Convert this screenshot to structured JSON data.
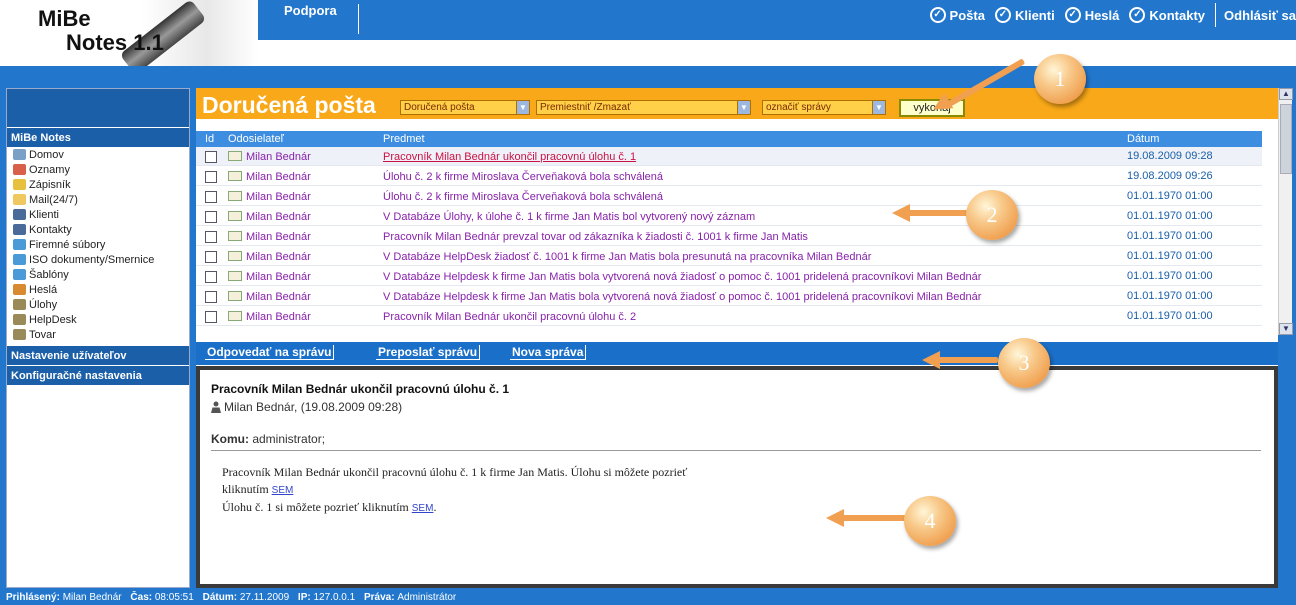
{
  "app": {
    "logo_line1": "MiBe",
    "logo_line2": "Notes 1.1"
  },
  "topnav": {
    "support": "Podpora",
    "links": [
      "Pošta",
      "Klienti",
      "Heslá",
      "Kontakty"
    ],
    "logout": "Odhlásiť sa"
  },
  "sidebar": {
    "section_title": "MiBe Notes",
    "items": [
      {
        "label": "Domov",
        "icon": "home-icon"
      },
      {
        "label": "Oznamy",
        "icon": "announcement-icon"
      },
      {
        "label": "Zápisník",
        "icon": "notepad-icon"
      },
      {
        "label": "Mail(24/7)",
        "icon": "mail-icon"
      },
      {
        "label": "Klienti",
        "icon": "contact-card-icon"
      },
      {
        "label": "Kontakty",
        "icon": "contact-card-icon"
      },
      {
        "label": "Firemné súbory",
        "icon": "folder-icon"
      },
      {
        "label": "ISO dokumenty/Smernice",
        "icon": "folder-icon"
      },
      {
        "label": "Šablóny",
        "icon": "folder-icon"
      },
      {
        "label": "Heslá",
        "icon": "key-icon"
      },
      {
        "label": "Úlohy",
        "icon": "task-icon"
      },
      {
        "label": "HelpDesk",
        "icon": "task-icon"
      },
      {
        "label": "Tovar",
        "icon": "task-icon"
      }
    ],
    "user_settings": "Nastavenie užívateľov",
    "config_settings": "Konfiguračné nastavenia"
  },
  "inbox": {
    "title": "Doručená pošta",
    "folder_select": "Doručená pošta",
    "action_select": "Premiestniť /Zmazať",
    "mark_select": "označiť správy",
    "execute": "vykonaj"
  },
  "table": {
    "headers": {
      "id": "Id",
      "sender": "Odosielateľ",
      "subject": "Predmet",
      "date": "Dátum"
    },
    "rows": [
      {
        "sender": "Milan Bednár",
        "subject": "Pracovník Milan Bednár ukončil pracovnú úlohu č. 1",
        "date": "19.08.2009 09:28"
      },
      {
        "sender": "Milan Bednár",
        "subject": "Úlohu č. 2 k firme Miroslava Červeňaková bola schválená",
        "date": "19.08.2009 09:26"
      },
      {
        "sender": "Milan Bednár",
        "subject": "Úlohu č. 2 k firme Miroslava Červeňaková bola schválená",
        "date": "01.01.1970 01:00"
      },
      {
        "sender": "Milan Bednár",
        "subject": "V Databáze Úlohy, k úlohe č. 1 k firme Jan Matis bol vytvorený nový záznam",
        "date": "01.01.1970 01:00"
      },
      {
        "sender": "Milan Bednár",
        "subject": "Pracovník Milan Bednár prevzal tovar od zákazníka k žiadosti č. 1001 k firme Jan Matis",
        "date": "01.01.1970 01:00"
      },
      {
        "sender": "Milan Bednár",
        "subject": "V Databáze HelpDesk žiadosť č. 1001 k firme Jan Matis bola presunutá na pracovníka Milan Bednár",
        "date": "01.01.1970 01:00"
      },
      {
        "sender": "Milan Bednár",
        "subject": "V Databáze Helpdesk k firme Jan Matis bola vytvorená nová žiadosť o pomoc č. 1001 pridelená pracovníkovi Milan Bednár",
        "date": "01.01.1970 01:00"
      },
      {
        "sender": "Milan Bednár",
        "subject": "V Databáze Helpdesk k firme Jan Matis bola vytvorená nová žiadosť o pomoc č. 1001 pridelená pracovníkovi Milan Bednár",
        "date": "01.01.1970 01:00"
      },
      {
        "sender": "Milan Bednár",
        "subject": "Pracovník Milan Bednár ukončil pracovnú úlohu č. 2",
        "date": "01.01.1970 01:00"
      }
    ]
  },
  "actions": {
    "reply": "Odpovedať na správu",
    "forward": "Preposlať správu",
    "new": "Nova správa"
  },
  "message": {
    "subject": "Pracovník Milan Bednár ukončil pracovnú úlohu č. 1",
    "from": "Milan Bednár, (19.08.2009 09:28)",
    "to_label": "Komu:",
    "to_value": " administrator;",
    "body_line1": "Pracovník Milan Bednár ukončil pracovnú úlohu č. 1 k firme Jan Matis. Úlohu si môžete pozrieť",
    "body_line2": "kliknutím ",
    "body_link": "SEM",
    "body_line3": "Úlohu č. 1 si môžete pozrieť kliknutím ",
    "body_link2": "SEM",
    "body_tail": "."
  },
  "status": {
    "user_label": "Prihlásený:",
    "user": "Milan Bednár",
    "time_label": "Čas:",
    "time": "08:05:51",
    "date_label": "Dátum:",
    "date": "27.11.2009",
    "ip_label": "IP:",
    "ip": "127.0.0.1",
    "rights_label": "Práva:",
    "rights": "Administrátor"
  },
  "callouts": [
    "1",
    "2",
    "3",
    "4"
  ],
  "colors": {
    "header_blue": "#2277cc",
    "inbox_orange": "#f8a818",
    "callout": "#f0a050",
    "link_purple": "#8822aa"
  }
}
